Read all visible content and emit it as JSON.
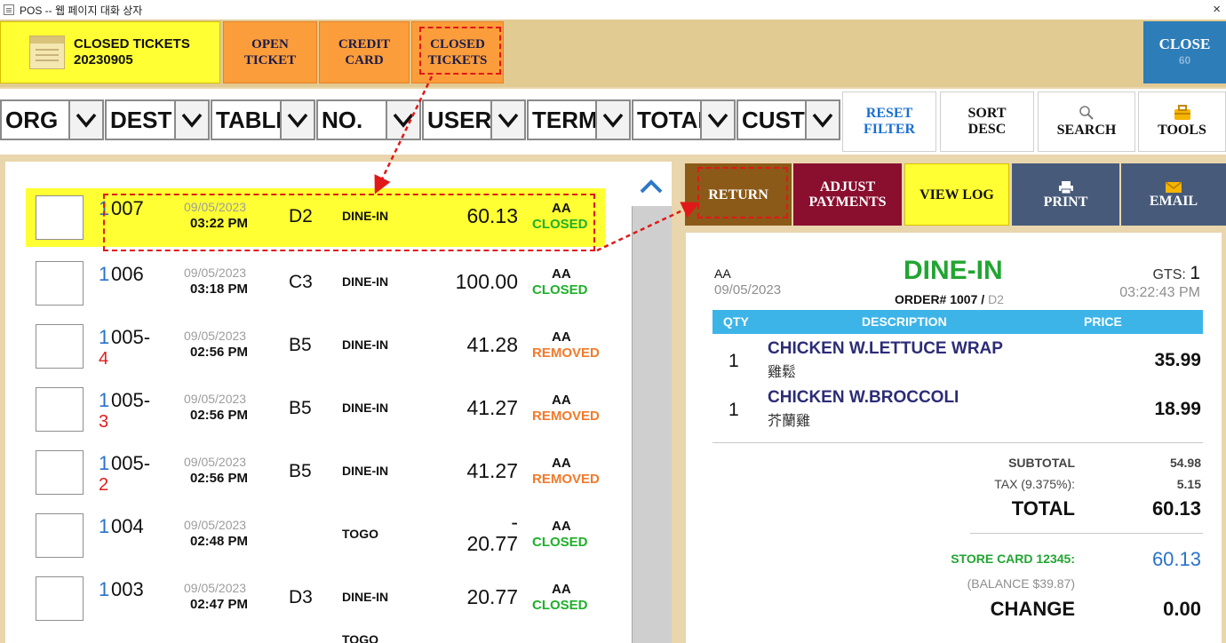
{
  "window": {
    "title": "POS -- 웹 페이지 대화 상자",
    "close_glyph": "×"
  },
  "header": {
    "date_tile": {
      "line1": "CLOSED TICKETS",
      "line2": "20230905"
    },
    "open_ticket": {
      "line1": "OPEN",
      "line2": "TICKET"
    },
    "credit_card": {
      "line1": "CREDIT",
      "line2": "CARD"
    },
    "closed_tickets": {
      "line1": "CLOSED",
      "line2": "TICKETS"
    },
    "close": {
      "label": "CLOSE",
      "sub": "60"
    }
  },
  "filters": [
    {
      "label": "ORG"
    },
    {
      "label": "DEST"
    },
    {
      "label": "TABLE"
    },
    {
      "label": "NO."
    },
    {
      "label": "USER"
    },
    {
      "label": "TERM"
    },
    {
      "label": "TOTAL"
    },
    {
      "label": "CUST"
    }
  ],
  "tools": {
    "reset": {
      "line1": "RESET",
      "line2": "FILTER"
    },
    "sort": {
      "line1": "SORT",
      "line2": "DESC"
    },
    "search": {
      "label": "SEARCH"
    },
    "tools": {
      "label": "TOOLS"
    }
  },
  "tickets": [
    {
      "term": "1",
      "no": "007",
      "sub": "",
      "date": "09/05/2023",
      "time": "03:22 PM",
      "table": "D2",
      "type": "DINE-IN",
      "amount": "60.13",
      "user": "AA",
      "status": "CLOSED"
    },
    {
      "term": "1",
      "no": "006",
      "sub": "",
      "date": "09/05/2023",
      "time": "03:18 PM",
      "table": "C3",
      "type": "DINE-IN",
      "amount": "100.00",
      "user": "AA",
      "status": "CLOSED"
    },
    {
      "term": "1",
      "no": "005-",
      "sub": "4",
      "date": "09/05/2023",
      "time": "02:56 PM",
      "table": "B5",
      "type": "DINE-IN",
      "amount": "41.28",
      "user": "AA",
      "status": "REMOVED"
    },
    {
      "term": "1",
      "no": "005-",
      "sub": "3",
      "date": "09/05/2023",
      "time": "02:56 PM",
      "table": "B5",
      "type": "DINE-IN",
      "amount": "41.27",
      "user": "AA",
      "status": "REMOVED"
    },
    {
      "term": "1",
      "no": "005-",
      "sub": "2",
      "date": "09/05/2023",
      "time": "02:56 PM",
      "table": "B5",
      "type": "DINE-IN",
      "amount": "41.27",
      "user": "AA",
      "status": "REMOVED"
    },
    {
      "term": "1",
      "no": "004",
      "sub": "",
      "date": "09/05/2023",
      "time": "02:48 PM",
      "table": "",
      "type": "TOGO",
      "amount": "-\n20.77",
      "user": "AA",
      "status": "CLOSED"
    },
    {
      "term": "1",
      "no": "003",
      "sub": "",
      "date": "09/05/2023",
      "time": "02:47 PM",
      "table": "D3",
      "type": "DINE-IN",
      "amount": "20.77",
      "user": "AA",
      "status": "CLOSED"
    },
    {
      "term": "",
      "no": "",
      "sub": "",
      "date": "",
      "time": "",
      "table": "",
      "type": "TOGO",
      "amount": "",
      "user": "",
      "status": ""
    }
  ],
  "actions": {
    "return": "RETURN",
    "adjust": {
      "line1": "ADJUST",
      "line2": "PAYMENTS"
    },
    "view_log": "VIEW LOG",
    "print": "PRINT",
    "email": "EMAIL"
  },
  "receipt": {
    "user": "AA",
    "date": "09/05/2023",
    "title": "DINE-IN",
    "order_label": "ORDER# 1007 /",
    "order_table": "D2",
    "gts_label": "GTS:",
    "gts_value": "1",
    "time": "03:22:43 PM",
    "columns": {
      "qty": "QTY",
      "desc": "DESCRIPTION",
      "price": "PRICE"
    },
    "items": [
      {
        "qty": "1",
        "name": "CHICKEN W.LETTUCE WRAP",
        "cn": "雞鬆",
        "price": "35.99"
      },
      {
        "qty": "1",
        "name": "CHICKEN W.BROCCOLI",
        "cn": "芥蘭雞",
        "price": "18.99"
      }
    ],
    "subtotal_label": "SUBTOTAL",
    "subtotal": "54.98",
    "tax_label": "TAX (9.375%):",
    "tax": "5.15",
    "total_label": "TOTAL",
    "total": "60.13",
    "payment_label": "STORE CARD 12345:",
    "payment": "60.13",
    "balance": "(BALANCE $39.87)",
    "change_label": "CHANGE",
    "change": "0.00"
  },
  "colors": {
    "annotation": "#e01818",
    "closed": "#1fb02a",
    "removed": "#f27a2a",
    "selected_row": "#ffff33",
    "orange_button": "#fb9d3b",
    "close_button": "#2d7db8"
  }
}
